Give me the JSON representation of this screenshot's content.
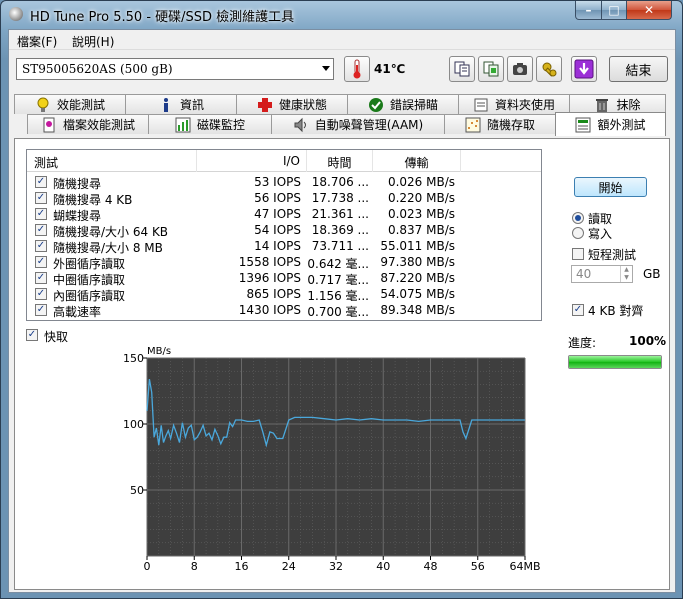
{
  "window": {
    "title": "HD Tune Pro 5.50 - 硬碟/SSD 檢測維護工具",
    "min_glyph": "–",
    "max_glyph": "□",
    "close_glyph": "✕"
  },
  "menu": [
    "檔案(F)",
    "說明(H)"
  ],
  "toolbar": {
    "drive": "ST95005620AS (500 gB)",
    "temperature": "41℃",
    "exit_label": "結束"
  },
  "tabs_row1": [
    "效能測試",
    "資訊",
    "健康狀態",
    "錯誤掃瞄",
    "資料夾使用",
    "抹除"
  ],
  "tabs_row2": [
    "檔案效能測試",
    "磁碟監控",
    "自動噪聲管理(AAM)",
    "隨機存取",
    "額外測試"
  ],
  "active_tab": "額外測試",
  "table": {
    "headers": {
      "test": "測試",
      "io": "I/O",
      "time": "時間",
      "transfer": "傳輸"
    },
    "rows": [
      {
        "checked": true,
        "name": "隨機搜尋",
        "io": "53 IOPS",
        "time": "18.706 ...",
        "transfer": "0.026 MB/s"
      },
      {
        "checked": true,
        "name": "隨機搜尋 4 KB",
        "io": "56 IOPS",
        "time": "17.738 ...",
        "transfer": "0.220 MB/s"
      },
      {
        "checked": true,
        "name": "蝴蝶搜尋",
        "io": "47 IOPS",
        "time": "21.361 ...",
        "transfer": "0.023 MB/s"
      },
      {
        "checked": true,
        "name": "隨機搜尋/大小 64 KB",
        "io": "54 IOPS",
        "time": "18.369 ...",
        "transfer": "0.837 MB/s"
      },
      {
        "checked": true,
        "name": "隨機搜尋/大小 8 MB",
        "io": "14 IOPS",
        "time": "73.711 ...",
        "transfer": "55.011 MB/s"
      },
      {
        "checked": true,
        "name": "外圈循序讀取",
        "io": "1558 IOPS",
        "time": "0.642 毫...",
        "transfer": "97.380 MB/s"
      },
      {
        "checked": true,
        "name": "中圈循序讀取",
        "io": "1396 IOPS",
        "time": "0.717 毫...",
        "transfer": "87.220 MB/s"
      },
      {
        "checked": true,
        "name": "內圈循序讀取",
        "io": "865 IOPS",
        "time": "1.156 毫...",
        "transfer": "54.075 MB/s"
      },
      {
        "checked": true,
        "name": "高載速率",
        "io": "1430 IOPS",
        "time": "0.700 毫...",
        "transfer": "89.348 MB/s"
      }
    ]
  },
  "options": {
    "quick_label": "快取",
    "quick_checked": true,
    "start_label": "開始",
    "read_label": "讀取",
    "write_label": "寫入",
    "mode": "read",
    "short_test_label": "短程測試",
    "short_test_checked": false,
    "size_value": "40",
    "size_unit": "GB",
    "align_label": "4 KB 對齊",
    "align_checked": true,
    "progress_label": "進度:",
    "progress_value": "100%",
    "progress_fraction": 1.0
  },
  "colors": {
    "plot_bg": "#3e3e3e",
    "grid": "#6a6a6a",
    "line": "#4aa8dc",
    "progress": "#22c622"
  },
  "chart_data": {
    "type": "line",
    "ylabel": "MB/s",
    "xlabel_unit": "MB",
    "xlim": [
      0,
      64
    ],
    "ylim": [
      0,
      150
    ],
    "yticks": [
      50,
      100,
      150
    ],
    "xticks": [
      0,
      8,
      16,
      24,
      32,
      40,
      48,
      56,
      64
    ],
    "xtick_labels": [
      "0",
      "8",
      "16",
      "24",
      "32",
      "40",
      "48",
      "56",
      "64MB"
    ],
    "grid": true,
    "series": [
      {
        "x": [
          0,
          0.4,
          0.8,
          1.2,
          1.6,
          2.0,
          2.4,
          2.8,
          3.2,
          3.6,
          4.0,
          4.5,
          5.0,
          5.5,
          6.0,
          6.5,
          7.0,
          7.5,
          8.0,
          8.5,
          9.0,
          9.5,
          10.0,
          10.5,
          11.0,
          11.5,
          12.0,
          12.5,
          13.0,
          13.5,
          14.0,
          14.5,
          15.0,
          16.0,
          17.0,
          18.0,
          19.0,
          19.6,
          20.2,
          20.8,
          21.4,
          22.0,
          23.0,
          24.0,
          25.0,
          26.0,
          28.0,
          30.0,
          32.0,
          34.0,
          36.0,
          38.0,
          40.0,
          42.0,
          44.0,
          46.0,
          48.0,
          50.0,
          52.0,
          53.0,
          53.5,
          54.0,
          55.0,
          56.0,
          58.0,
          60.0,
          62.0,
          64.0
        ],
        "y": [
          110,
          134,
          124,
          90,
          97,
          84,
          99,
          86,
          91,
          95,
          89,
          99,
          93,
          86,
          101,
          90,
          97,
          99,
          88,
          90,
          94,
          99,
          91,
          93,
          88,
          96,
          91,
          85,
          90,
          90,
          101,
          98,
          103,
          103,
          102,
          102,
          103,
          94,
          84,
          94,
          93,
          89,
          89,
          103,
          105,
          105,
          105,
          104,
          103,
          104,
          103,
          104,
          103,
          103,
          103,
          102,
          103,
          103,
          103,
          103,
          94,
          89,
          103,
          103,
          103,
          103,
          103,
          103
        ]
      }
    ]
  }
}
